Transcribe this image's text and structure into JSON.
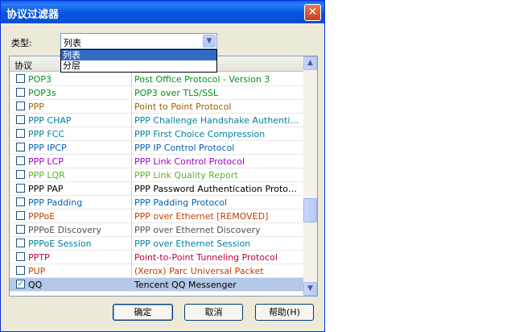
{
  "window": {
    "title": "协议过滤器",
    "close": "✕"
  },
  "type_filter": {
    "label": "类型:",
    "value": "列表",
    "options": [
      "列表",
      "分层"
    ],
    "selected_index": 0
  },
  "table": {
    "columns": [
      "协议",
      ""
    ],
    "rows": [
      {
        "name": "POP3",
        "desc": "Post Office Protocol - Version 3",
        "checked": false,
        "color": "#00901a"
      },
      {
        "name": "POP3s",
        "desc": "POP3 over TLS/SSL",
        "checked": false,
        "color": "#00901a"
      },
      {
        "name": "PPP",
        "desc": "Point to Point Protocol",
        "checked": false,
        "color": "#a06000"
      },
      {
        "name": "PPP CHAP",
        "desc": "PPP Challenge Handshake Authentica...",
        "checked": false,
        "color": "#0080a0"
      },
      {
        "name": "PPP FCC",
        "desc": "PPP First Choice Compression",
        "checked": false,
        "color": "#0080a0"
      },
      {
        "name": "PPP IPCP",
        "desc": "PPP IP Control Protocol",
        "checked": false,
        "color": "#0060b0"
      },
      {
        "name": "PPP LCP",
        "desc": "PPP Link Control Protocol",
        "checked": false,
        "color": "#a000c0"
      },
      {
        "name": "PPP LQR",
        "desc": "PPP Link Quality Report",
        "checked": false,
        "color": "#60b030"
      },
      {
        "name": "PPP PAP",
        "desc": "PPP Password Authentication Protocol",
        "checked": false,
        "color": "#000000"
      },
      {
        "name": "PPP Padding",
        "desc": "PPP Padding Protocol",
        "checked": false,
        "color": "#0060b0"
      },
      {
        "name": "PPPoE",
        "desc": "PPP over Ethernet [REMOVED]",
        "checked": false,
        "color": "#c04000"
      },
      {
        "name": "PPPoE Discovery",
        "desc": "PPP over Ethernet Discovery",
        "checked": false,
        "color": "#505050"
      },
      {
        "name": "PPPoE Session",
        "desc": "PPP over Ethernet Session",
        "checked": false,
        "color": "#0080a0"
      },
      {
        "name": "PPTP",
        "desc": "Point-to-Point Tunneling Protocol",
        "checked": false,
        "color": "#c00040"
      },
      {
        "name": "PUP",
        "desc": "(Xerox) Parc Universal Packet",
        "checked": false,
        "color": "#c04000"
      },
      {
        "name": "QQ",
        "desc": "Tencent QQ Messenger",
        "checked": true,
        "color": "#000000"
      }
    ]
  },
  "buttons": {
    "ok": "确定",
    "cancel": "取消",
    "help": "帮助(H)"
  },
  "scroll": {
    "up": "▲",
    "down": "▼"
  },
  "icons": {
    "combo_arrow": "▼"
  },
  "colors": {
    "title_bar": "#0a5fe8",
    "selection": "#316ac5",
    "row_selected": "#b4c8e8"
  }
}
